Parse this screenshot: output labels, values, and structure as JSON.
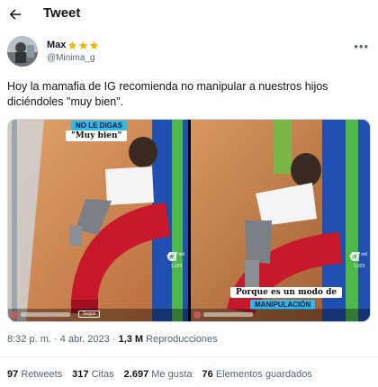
{
  "header": {
    "title": "Tweet",
    "back_icon": "arrow-left-icon"
  },
  "author": {
    "name": "Max",
    "stars": [
      "star-icon",
      "star-icon",
      "star-icon"
    ],
    "star_color": "#f4b400",
    "handle": "@Minima_g"
  },
  "tweet": {
    "text": "Hoy la mamafia de IG recomienda no manipular a nuestros hijos diciéndoles \"muy bien\"."
  },
  "media": {
    "left": {
      "tag": "NO LE DIGAS",
      "caption": "\"Muy bien\""
    },
    "right": {
      "caption": "Porque es un modo de",
      "tag": "MANIPULACIÓN"
    },
    "reel_actions": [
      {
        "icon": "heart-icon",
        "count": "26,2 mil"
      },
      {
        "icon": "comment-icon",
        "count": "1,023"
      },
      {
        "icon": "send-icon",
        "count": ""
      }
    ],
    "follow_label": "Seguir",
    "tag_color": "#2fb8e8"
  },
  "meta": {
    "time": "8:32 p. m.",
    "separator": "·",
    "date": "4 abr. 2023",
    "views_count": "1,3 M",
    "views_label": "Reproducciones"
  },
  "stats": [
    {
      "count": "97",
      "label": "Retweets"
    },
    {
      "count": "317",
      "label": "Citas"
    },
    {
      "count": "2.697",
      "label": "Me gusta"
    },
    {
      "count": "76",
      "label": "Elementos guardados"
    }
  ]
}
